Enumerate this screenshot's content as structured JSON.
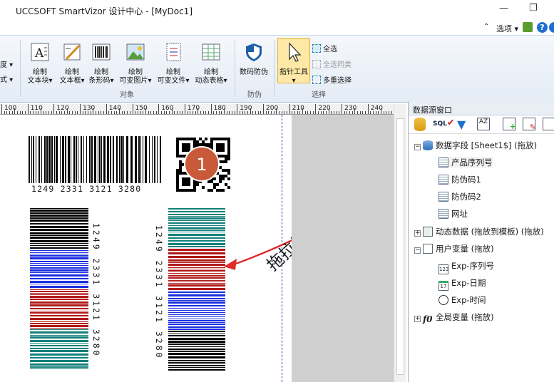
{
  "window": {
    "title": "UCCSOFT SmartVizor 设计中心 - [MyDoc1]",
    "min": "—",
    "restore": "❐",
    "close": "✕"
  },
  "quickbar": {
    "options_label": "选项"
  },
  "ribbon": {
    "left_partial": [
      "度",
      "式"
    ],
    "buttons": [
      {
        "line1": "绘制",
        "line2": "文本块"
      },
      {
        "line1": "绘制",
        "line2": "文本框"
      },
      {
        "line1": "绘制",
        "line2": "条形码"
      },
      {
        "line1": "绘制",
        "line2": "可变图片"
      },
      {
        "line1": "绘制",
        "line2": "可变文件"
      },
      {
        "line1": "绘制",
        "line2": "动态表格"
      }
    ],
    "group_objects": "对象",
    "anticounterfeit": {
      "label": "数码防伪",
      "group": "防伪"
    },
    "pointer": {
      "label": "指针工具"
    },
    "select_all": "全选",
    "select_same": "全选同类",
    "multi_select": "多重选择",
    "group_select": "选择"
  },
  "ruler": {
    "ticks": [
      "100",
      "110",
      "120",
      "130",
      "140",
      "150",
      "160",
      "170",
      "180",
      "190",
      "200",
      "210",
      "220",
      "230",
      "240"
    ]
  },
  "canvas": {
    "barcode_text": "1249 2331 3121 3280",
    "left_vertical_text": "1249 2331 3121 3280",
    "right_vertical_text": "1249 2331 3121 3280",
    "badge": "1",
    "annotation": "拖拉绑定可变数据",
    "colors": {
      "black": "#000000",
      "blue": "#1a2ee0",
      "red": "#b01818",
      "teal": "#127f7a",
      "arrow": "#e02b2b",
      "badge": "#c85a3a"
    }
  },
  "panel": {
    "title": "数据源窗口",
    "tree": [
      {
        "label": "数据字段 [Sheet1$] (拖放)",
        "icon": "database-icon"
      },
      {
        "label": "产品序列号",
        "icon": "field-icon"
      },
      {
        "label": "防伪码1",
        "icon": "field-icon"
      },
      {
        "label": "防伪码2",
        "icon": "field-icon"
      },
      {
        "label": "网址",
        "icon": "field-icon"
      },
      {
        "label": "动态数据 (拖放到模板) (拖放)",
        "icon": "dynamic-data-icon"
      },
      {
        "label": "用户变量 (拖放)",
        "icon": "user-var-icon"
      },
      {
        "label": "Exp-序列号",
        "icon": "serial-icon"
      },
      {
        "label": "Exp-日期",
        "icon": "calendar-icon"
      },
      {
        "label": "Exp-时间",
        "icon": "clock-icon"
      },
      {
        "label": "全局变量 (拖放)",
        "icon": "function-icon"
      }
    ]
  }
}
